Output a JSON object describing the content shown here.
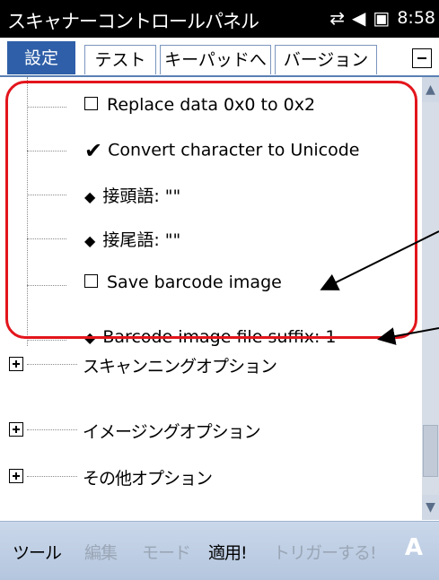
{
  "titlebar": {
    "title": "スキャナーコントロールパネル",
    "icons": [
      "connectivity-icon",
      "volume-icon",
      "battery-icon"
    ],
    "time": "8:58"
  },
  "tabs": [
    {
      "label": "設定",
      "active": true
    },
    {
      "label": "テスト",
      "active": false
    },
    {
      "label": "キーパッドへ",
      "active": false
    },
    {
      "label": "バージョン",
      "active": false
    }
  ],
  "tree": {
    "items": [
      {
        "symbol": "checkbox-unchecked",
        "label": "Replace data 0x0 to 0x2"
      },
      {
        "symbol": "checkbox-checked",
        "label": "Convert character to Unicode"
      },
      {
        "symbol": "diamond",
        "label": "接頭語: \"\""
      },
      {
        "symbol": "diamond",
        "label": "接尾語: \"\""
      },
      {
        "symbol": "checkbox-unchecked",
        "label": "Save barcode image"
      },
      {
        "symbol": "diamond",
        "label": "Barcode image file suffix: 1"
      }
    ],
    "categories": [
      {
        "label": "スキャンニングオプション"
      },
      {
        "label": "イメージングオプション"
      },
      {
        "label": "その他オプション"
      }
    ]
  },
  "bottom_menu": [
    {
      "label": "ツール",
      "enabled": true
    },
    {
      "label": "編集",
      "enabled": false
    },
    {
      "label": "モード",
      "enabled": false
    },
    {
      "label": "適用!",
      "enabled": true
    },
    {
      "label": "トリガーする!",
      "enabled": false
    }
  ],
  "keyboard_label": "A",
  "colors": {
    "highlight_frame": "#e3151c",
    "tab_active": "#2f5fa8",
    "menu_bar": "#cad7ea"
  }
}
